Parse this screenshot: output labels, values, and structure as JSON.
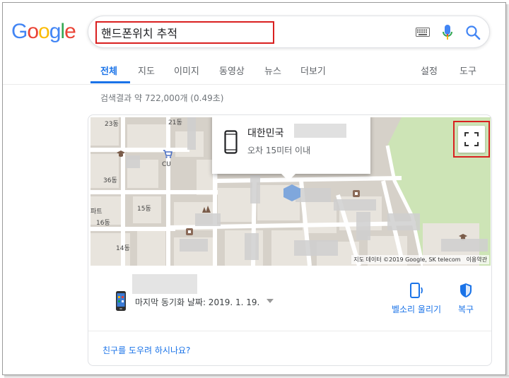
{
  "logo": {
    "text": "Google",
    "letters": [
      "G",
      "o",
      "o",
      "g",
      "l",
      "e"
    ],
    "colors": [
      "#4285F4",
      "#EA4335",
      "#FBBC05",
      "#4285F4",
      "#34A853",
      "#EA4335"
    ]
  },
  "search": {
    "query": "핸드폰위치 추적",
    "highlight_color": "#d92020"
  },
  "tabs": [
    {
      "label": "전체",
      "active": true
    },
    {
      "label": "지도"
    },
    {
      "label": "이미지"
    },
    {
      "label": "동영상"
    },
    {
      "label": "뉴스"
    },
    {
      "label": "더보기"
    }
  ],
  "tools": {
    "settings": "설정",
    "tools": "도구"
  },
  "result_stats": "검색결과 약 722,000개 (0.49초)",
  "map": {
    "street_labels": [
      "23동",
      "21동",
      "CU",
      "36동",
      "15동",
      "파트",
      "16동",
      "14동"
    ],
    "attribution": "지도 데이터 ©2019 Google, SK telecom",
    "terms": "이용약관",
    "park_color": "#cde4b6",
    "marker_color": "#7fa7dc"
  },
  "popup": {
    "country": "대한민국",
    "accuracy": "오차 15미터 이내"
  },
  "device": {
    "last_sync": "마지막 동기화 날짜: 2019. 1. 19."
  },
  "actions": {
    "ring": "벨소리 울리기",
    "recover": "복구"
  },
  "help_link": "친구를 도우려 하시나요?",
  "accent_color": "#1a73e8"
}
